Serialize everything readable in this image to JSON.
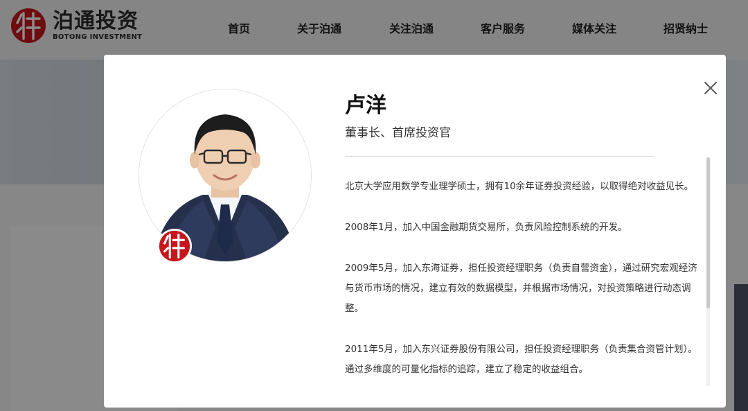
{
  "brand": {
    "name_cn": "泊通投资",
    "name_en": "BOTONG INVESTMENT",
    "color": "#c8161d"
  },
  "nav": {
    "items": [
      {
        "label": "首页"
      },
      {
        "label": "关于泊通"
      },
      {
        "label": "关注泊通"
      },
      {
        "label": "客户服务"
      },
      {
        "label": "媒体关注"
      },
      {
        "label": "招贤纳士"
      }
    ]
  },
  "modal": {
    "name": "卢洋",
    "title": "董事长、首席投资官",
    "close_icon": "close-icon",
    "bio": [
      "北京大学应用数学专业理学硕士，拥有10余年证券投资经验，以取得绝对收益见长。",
      "2008年1月，加入中国金融期货交易所，负责风险控制系统的开发。",
      "2009年5月，加入东海证券，担任投资经理职务（负责自营资金），通过研究宏观经济与货币市场的情况，建立有效的数据模型，并根据市场情况，对投资策略进行动态调整。",
      "2011年5月，加入东兴证券股份有限公司，担任投资经理职务（负责集合资管计划）。通过多维度的可量化指标的追踪，建立了稳定的收益组合。"
    ]
  }
}
